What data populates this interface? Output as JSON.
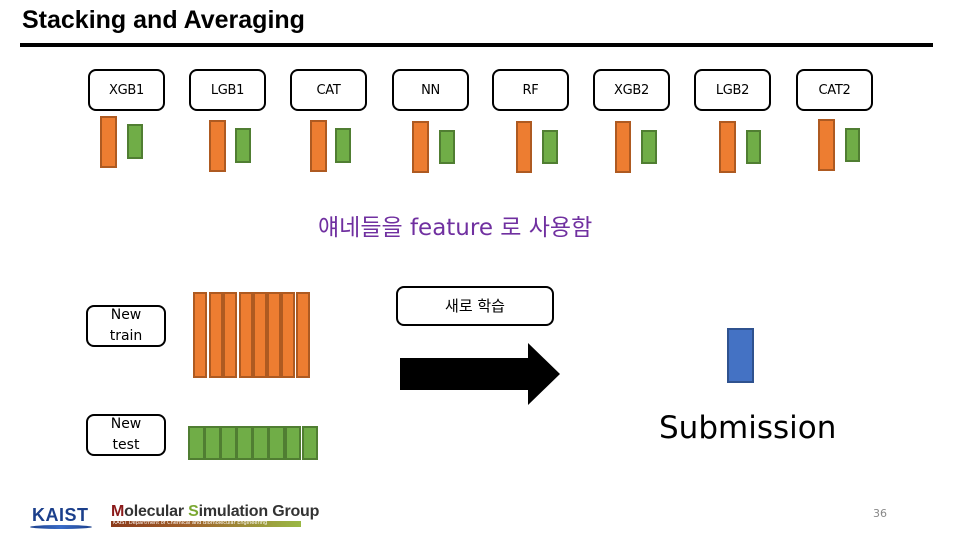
{
  "slide": {
    "title": "Stacking and Averaging",
    "page_number": "36"
  },
  "models": [
    {
      "label": "XGB1"
    },
    {
      "label": "LGB1"
    },
    {
      "label": "CAT"
    },
    {
      "label": "NN"
    },
    {
      "label": "RF"
    },
    {
      "label": "XGB2"
    },
    {
      "label": "LGB2"
    },
    {
      "label": "CAT2"
    }
  ],
  "legend_semantics": {
    "orange_bar": "train predictions (out-of-fold)",
    "green_bar": "test predictions",
    "blue_bar": "final submission"
  },
  "colors": {
    "train_orange": "#ed7d31",
    "test_green": "#70ad47",
    "submission_blue": "#4472c4",
    "note_purple": "#7030a0"
  },
  "feature_note": "얘네들을 feature 로 사용함",
  "new_train": {
    "line1": "New",
    "line2": "train",
    "column_count": 8
  },
  "new_test": {
    "line1": "New",
    "line2": "test",
    "column_count": 8
  },
  "retrain_label": "새로 학습",
  "submission_label": "Submission",
  "footer": {
    "kaist_logo": "KAIST",
    "group_name_m": "M",
    "group_name_1": "olecular ",
    "group_name_s": "S",
    "group_name_2": "imulation Group",
    "group_subtitle": "KAIST  Department of Chemical and Biomolecular Engineering"
  }
}
